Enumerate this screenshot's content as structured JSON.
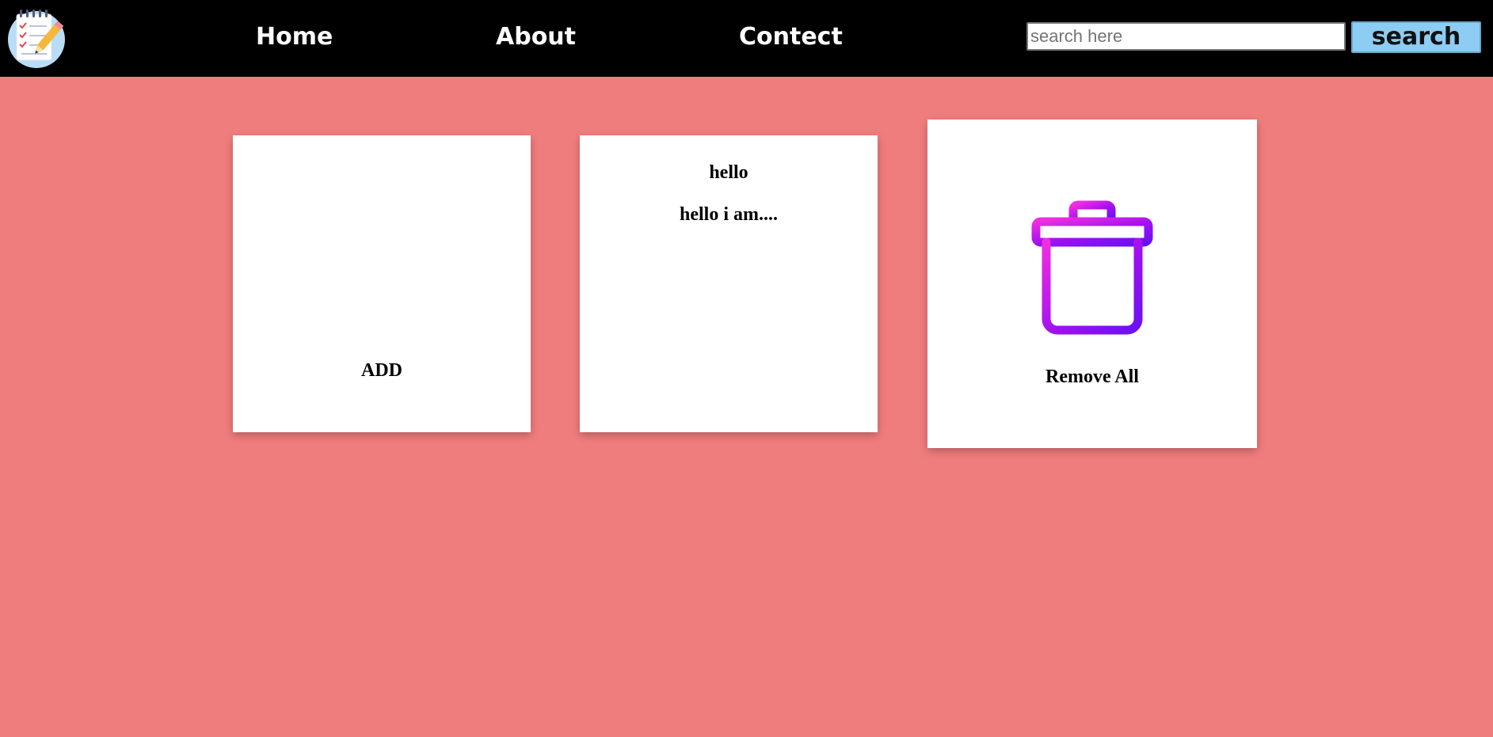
{
  "navbar": {
    "logo_icon": "notepad-checklist-pencil-icon",
    "links": [
      {
        "label": "Home"
      },
      {
        "label": "About"
      },
      {
        "label": "Contect"
      }
    ],
    "search": {
      "placeholder": "search here",
      "value": "",
      "button_label": "search"
    }
  },
  "cards": {
    "add": {
      "icon": "plus-icon",
      "label": "ADD"
    },
    "note": {
      "title": "hello",
      "body": "hello i am...."
    },
    "remove_all": {
      "icon": "trash-icon",
      "label": "Remove All"
    }
  },
  "colors": {
    "page_background": "#f07d7d",
    "navbar_background": "#000000",
    "search_button": "#8ecdf3",
    "card_background": "#ffffff"
  }
}
